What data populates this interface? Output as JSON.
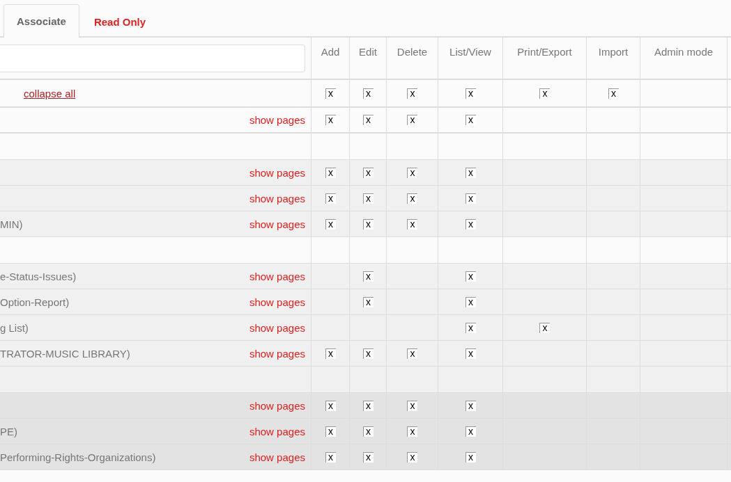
{
  "tabs": [
    {
      "label": "Associate",
      "selected": true
    },
    {
      "label": "Read Only",
      "selected": false
    }
  ],
  "columns": [
    "Add",
    "Edit",
    "Delete",
    "List/View",
    "Print/Export",
    "Import",
    "Admin mode"
  ],
  "rows": [
    {
      "kind": "toolbar",
      "color": "#fbfbfb",
      "link": "collapse all",
      "cells": [
        {
          "checked": true,
          "mark": "x"
        },
        {
          "checked": true,
          "mark": "x"
        },
        {
          "checked": true,
          "mark": "x"
        },
        {
          "checked": true,
          "mark": "x"
        },
        {
          "checked": true,
          "mark": "x"
        },
        {
          "checked": true,
          "mark": "x"
        },
        {
          "checked": false
        }
      ]
    },
    {
      "kind": "item",
      "color": "#fbfbfb",
      "action": "show pages",
      "cells": [
        {
          "checked": true,
          "mark": "x"
        },
        {
          "checked": true,
          "mark": "x"
        },
        {
          "checked": true,
          "mark": "x"
        },
        {
          "checked": true,
          "mark": "x"
        },
        {
          "checked": false
        },
        {
          "checked": false
        },
        {
          "checked": false
        }
      ]
    },
    {
      "kind": "blank",
      "color": "#fbfbfb",
      "cells": [
        {
          "checked": false
        },
        {
          "checked": false
        },
        {
          "checked": false
        },
        {
          "checked": false
        },
        {
          "checked": false
        },
        {
          "checked": false
        },
        {
          "checked": false
        }
      ]
    },
    {
      "kind": "item",
      "color": "#f0f0f0",
      "action": "show pages",
      "cells": [
        {
          "checked": true,
          "mark": "x"
        },
        {
          "checked": true,
          "mark": "x"
        },
        {
          "checked": true,
          "mark": "x"
        },
        {
          "checked": true,
          "mark": "x"
        },
        {
          "checked": false
        },
        {
          "checked": false
        },
        {
          "checked": false
        }
      ]
    },
    {
      "kind": "item",
      "color": "#f0f0f0",
      "action": "show pages",
      "cells": [
        {
          "checked": true,
          "mark": "x"
        },
        {
          "checked": true,
          "mark": "x"
        },
        {
          "checked": true,
          "mark": "x"
        },
        {
          "checked": true,
          "mark": "x"
        },
        {
          "checked": false
        },
        {
          "checked": false
        },
        {
          "checked": false
        }
      ]
    },
    {
      "kind": "item",
      "color": "#f0f0f0",
      "label": "MIN)",
      "action": "show pages",
      "cells": [
        {
          "checked": true,
          "mark": "x"
        },
        {
          "checked": true,
          "mark": "x"
        },
        {
          "checked": true,
          "mark": "x"
        },
        {
          "checked": true,
          "mark": "x"
        },
        {
          "checked": false
        },
        {
          "checked": false
        },
        {
          "checked": false
        }
      ]
    },
    {
      "kind": "blank",
      "color": "#fbfbfb",
      "cells": [
        {
          "checked": false
        },
        {
          "checked": false
        },
        {
          "checked": false
        },
        {
          "checked": false
        },
        {
          "checked": false
        },
        {
          "checked": false
        },
        {
          "checked": false
        }
      ]
    },
    {
      "kind": "item",
      "color": "#f0f0f0",
      "label": "e-Status-Issues)",
      "action": "show pages",
      "cells": [
        {
          "checked": false
        },
        {
          "checked": true,
          "mark": "x"
        },
        {
          "checked": false
        },
        {
          "checked": true,
          "mark": "x"
        },
        {
          "checked": false
        },
        {
          "checked": false
        },
        {
          "checked": false
        }
      ]
    },
    {
      "kind": "item",
      "color": "#f0f0f0",
      "label": "Option-Report)",
      "action": "show pages",
      "cells": [
        {
          "checked": false
        },
        {
          "checked": true,
          "mark": "x"
        },
        {
          "checked": false
        },
        {
          "checked": true,
          "mark": "x"
        },
        {
          "checked": false
        },
        {
          "checked": false
        },
        {
          "checked": false
        }
      ]
    },
    {
      "kind": "item",
      "color": "#f0f0f0",
      "label": "g List)",
      "action": "show pages",
      "cells": [
        {
          "checked": false
        },
        {
          "checked": false
        },
        {
          "checked": false
        },
        {
          "checked": true,
          "mark": "x"
        },
        {
          "checked": true,
          "mark": "x"
        },
        {
          "checked": false
        },
        {
          "checked": false
        }
      ]
    },
    {
      "kind": "item",
      "color": "#f0f0f0",
      "label": "TRATOR-MUSIC LIBRARY)",
      "action": "show pages",
      "cells": [
        {
          "checked": true,
          "mark": "x"
        },
        {
          "checked": true,
          "mark": "x"
        },
        {
          "checked": true,
          "mark": "x"
        },
        {
          "checked": true,
          "mark": "x"
        },
        {
          "checked": false
        },
        {
          "checked": false
        },
        {
          "checked": false
        }
      ]
    },
    {
      "kind": "blank",
      "color": "#f0f0f0",
      "cells": [
        {
          "checked": false
        },
        {
          "checked": false
        },
        {
          "checked": false
        },
        {
          "checked": false
        },
        {
          "checked": false
        },
        {
          "checked": false
        },
        {
          "checked": false
        }
      ]
    },
    {
      "kind": "item",
      "color": "#e3e3e3",
      "action": "show pages",
      "cells": [
        {
          "checked": true,
          "mark": "x"
        },
        {
          "checked": true,
          "mark": "x"
        },
        {
          "checked": true,
          "mark": "x"
        },
        {
          "checked": true,
          "mark": "x"
        },
        {
          "checked": false
        },
        {
          "checked": false
        },
        {
          "checked": false
        }
      ]
    },
    {
      "kind": "item",
      "color": "#e3e3e3",
      "label": "PE)",
      "action": "show pages",
      "cells": [
        {
          "checked": true,
          "mark": "x"
        },
        {
          "checked": true,
          "mark": "x"
        },
        {
          "checked": true,
          "mark": "x"
        },
        {
          "checked": true,
          "mark": "x"
        },
        {
          "checked": false
        },
        {
          "checked": false
        },
        {
          "checked": false
        }
      ]
    },
    {
      "kind": "item",
      "color": "#e3e3e3",
      "label": "Performing-Rights-Organizations)",
      "action": "show pages",
      "cells": [
        {
          "checked": true,
          "mark": "x"
        },
        {
          "checked": true,
          "mark": "x"
        },
        {
          "checked": true,
          "mark": "x"
        },
        {
          "checked": true,
          "mark": "x"
        },
        {
          "checked": false
        },
        {
          "checked": false
        },
        {
          "checked": false
        }
      ]
    }
  ]
}
